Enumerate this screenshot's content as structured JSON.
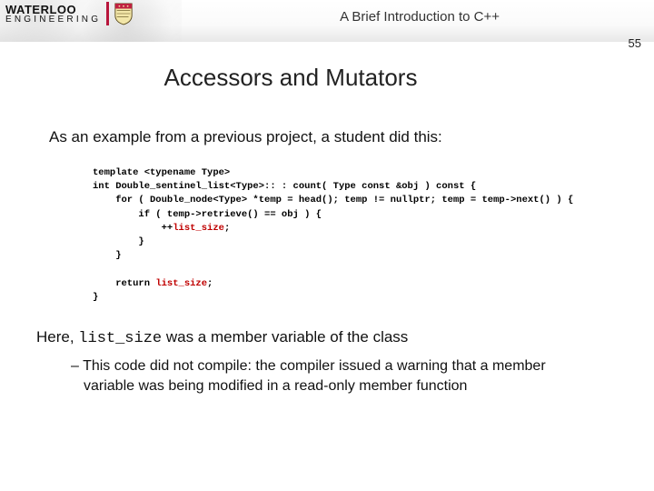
{
  "header": {
    "logo_top": "WATERLOO",
    "logo_bottom": "ENGINEERING",
    "doc_title": "A Brief Introduction to C++",
    "page_number": "55"
  },
  "title": "Accessors and Mutators",
  "intro": "As an example from a previous project, a student did this:",
  "code": {
    "l1": "template <typename Type>",
    "l2": "int Double_sentinel_list<Type>:: : count( Type const &obj ) const {",
    "l3": "    for ( Double_node<Type> *temp = head(); temp != nullptr; temp = temp->next() ) {",
    "l4": "        if ( temp->retrieve() == obj ) {",
    "l5a": "            ++",
    "l5b": "list_size",
    "l5c": ";",
    "l6": "        }",
    "l7": "    }",
    "l8": "",
    "l9a": "    return ",
    "l9b": "list_size",
    "l9c": ";",
    "l10": "}"
  },
  "outro_a": "Here, ",
  "outro_mono": "list_size",
  "outro_b": " was a member variable of the class",
  "bullet": "This code did not compile:  the compiler issued a warning that a member variable was being modified in a read-only member function"
}
